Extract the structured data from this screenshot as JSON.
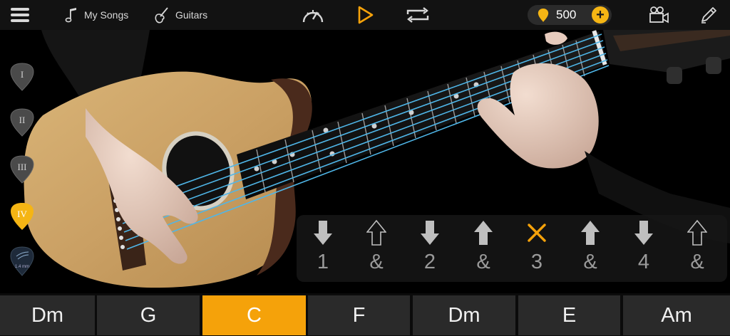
{
  "topbar": {
    "my_songs": "My Songs",
    "guitars": "Guitars",
    "coins": "500"
  },
  "picks": [
    {
      "label": "I",
      "state": "inactive"
    },
    {
      "label": "II",
      "state": "inactive"
    },
    {
      "label": "III",
      "state": "inactive"
    },
    {
      "label": "IV",
      "state": "active"
    },
    {
      "label": "1.4 mm",
      "state": "inactive"
    }
  ],
  "strum_pattern": [
    {
      "count": "1",
      "stroke": "down",
      "style": "filled"
    },
    {
      "count": "&",
      "stroke": "up",
      "style": "outline"
    },
    {
      "count": "2",
      "stroke": "down",
      "style": "filled"
    },
    {
      "count": "&",
      "stroke": "up",
      "style": "filled"
    },
    {
      "count": "3",
      "stroke": "mute",
      "style": "x"
    },
    {
      "count": "&",
      "stroke": "up",
      "style": "filled"
    },
    {
      "count": "4",
      "stroke": "down",
      "style": "filled"
    },
    {
      "count": "&",
      "stroke": "up",
      "style": "outline"
    }
  ],
  "chords": [
    {
      "name": "Dm",
      "active": false
    },
    {
      "name": "G",
      "active": false
    },
    {
      "name": "C",
      "active": true
    },
    {
      "name": "F",
      "active": false
    },
    {
      "name": "Dm",
      "active": false
    },
    {
      "name": "E",
      "active": false
    },
    {
      "name": "Am",
      "active": false
    }
  ],
  "colors": {
    "accent": "#f5a20a",
    "coin": "#f5b514",
    "string": "#4fb6e8",
    "topbar": "#121212",
    "chord_bg": "#2a2a2a"
  },
  "icons": {
    "menu": "hamburger-icon",
    "songs": "music-note-icon",
    "guitars": "guitar-icon",
    "tempo": "speedometer-icon",
    "play": "play-icon",
    "loop": "repeat-icon",
    "coin": "coin-icon",
    "camera": "video-camera-icon",
    "edit": "pencil-icon"
  }
}
